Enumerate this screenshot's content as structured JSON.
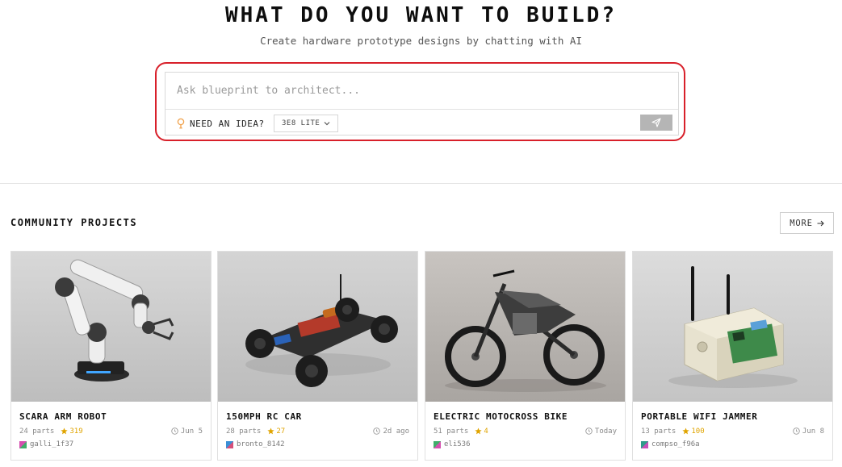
{
  "hero": {
    "title": "WHAT DO YOU WANT TO BUILD?",
    "subtitle": "Create hardware prototype designs by chatting with AI"
  },
  "prompt": {
    "placeholder": "Ask blueprint to architect...",
    "value": "",
    "idea_label": "NEED AN IDEA?",
    "idea_icon": "lightbulb-icon",
    "model_label": "3E8 LITE",
    "model_icon": "chevron-down-icon",
    "send_icon": "send-icon"
  },
  "colors": {
    "highlight": "#d8202a",
    "star": "#e0a400",
    "send_button": "#b5b5b5",
    "idea_icon": "#f0a14a"
  },
  "community": {
    "title": "COMMUNITY PROJECTS",
    "more_label": "MORE",
    "more_icon": "arrow-right-icon",
    "cards": [
      {
        "title": "SCARA ARM ROBOT",
        "parts": "24 parts",
        "stars": "319",
        "date": "Jun 5",
        "user": "galli_1f37",
        "image": "robot-arm-image"
      },
      {
        "title": "150MPH RC CAR",
        "parts": "28 parts",
        "stars": "27",
        "date": "2d ago",
        "user": "bronto_8142",
        "image": "rc-car-image"
      },
      {
        "title": "ELECTRIC MOTOCROSS BIKE",
        "parts": "51 parts",
        "stars": "4",
        "date": "Today",
        "user": "eli536",
        "image": "motocross-bike-image"
      },
      {
        "title": "PORTABLE WIFI JAMMER",
        "parts": "13 parts",
        "stars": "100",
        "date": "Jun 8",
        "user": "compso_f96a",
        "image": "wifi-jammer-image"
      }
    ]
  }
}
